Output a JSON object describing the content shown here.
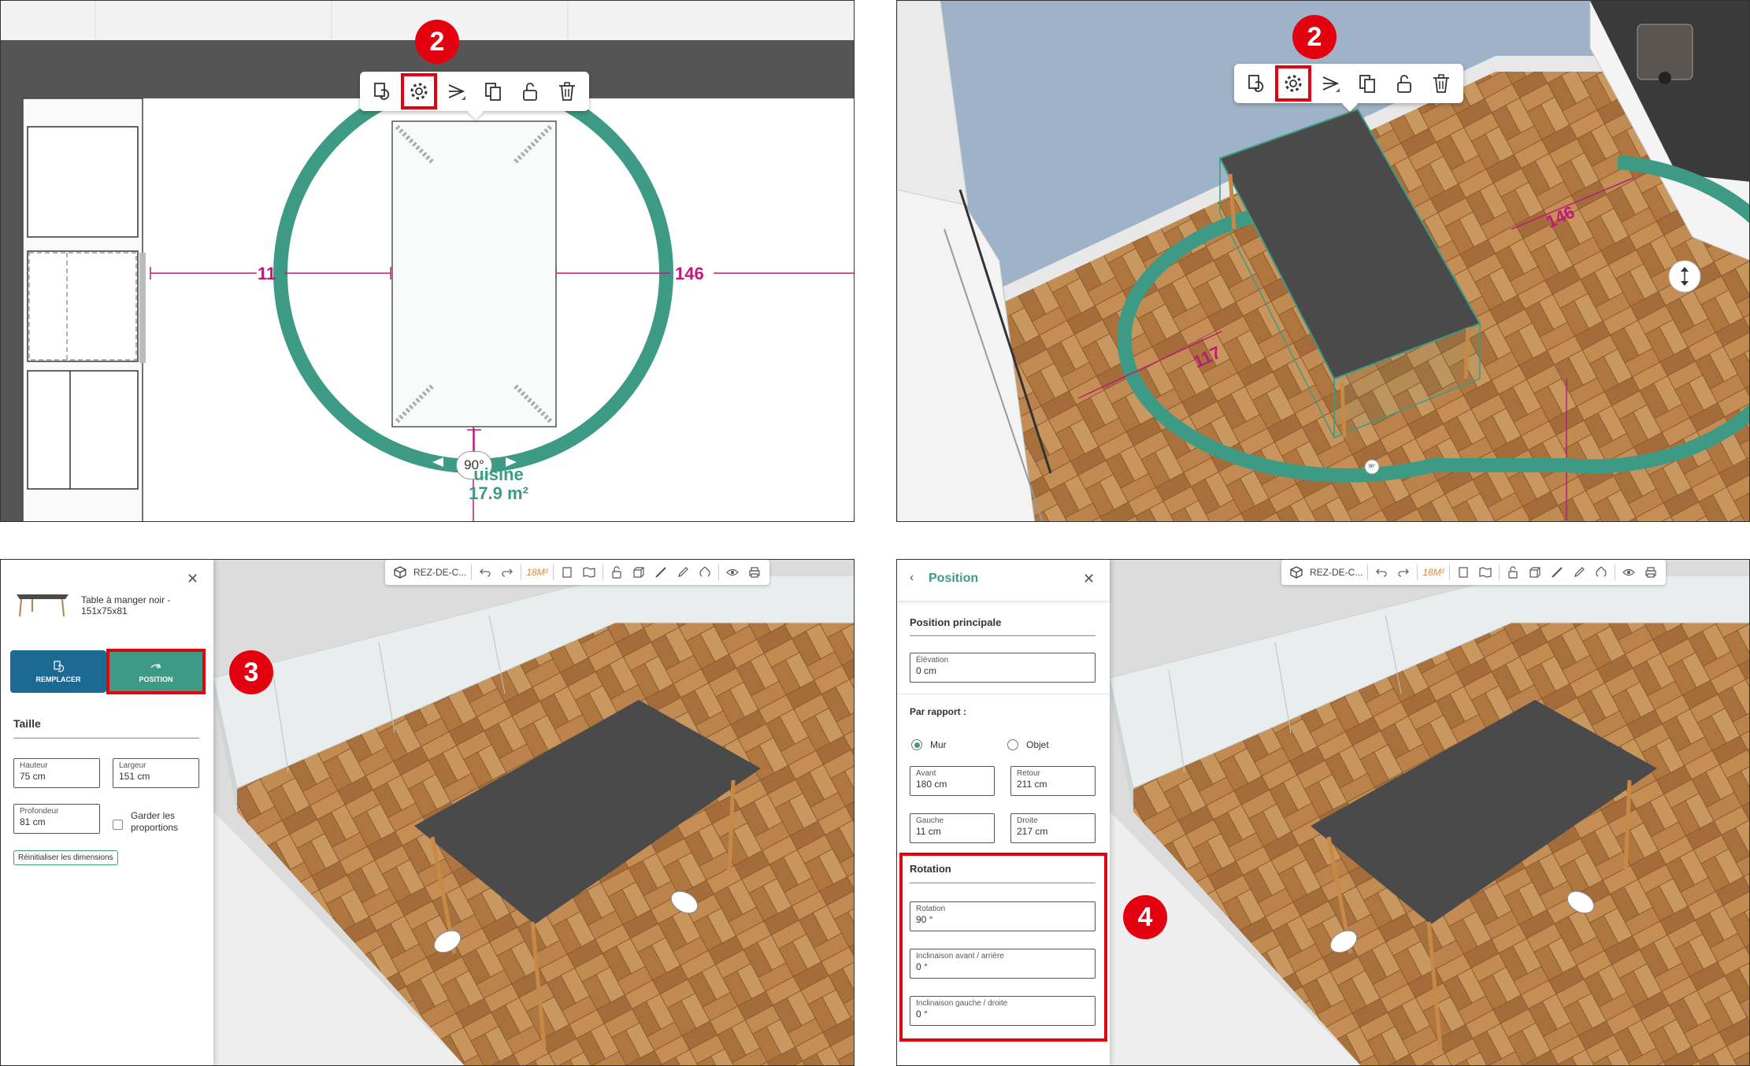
{
  "toolbar_popup": {
    "icons": [
      "replace-icon",
      "gear-icon",
      "align-icon",
      "duplicate-icon",
      "unlock-icon",
      "trash-icon"
    ]
  },
  "steps": {
    "s2a": "2",
    "s2b": "2",
    "s3": "3",
    "s4": "4"
  },
  "plan2d": {
    "dim_left": "11",
    "dim_right": "146",
    "angle": "90°",
    "room_name": "uisine",
    "room_area": "17.9 m²"
  },
  "view3d_top": {
    "dim_left": "117",
    "dim_right": "146",
    "angle": "90°"
  },
  "main_toolbar": {
    "level": "REZ-DE-C...",
    "surface": "18M²"
  },
  "size_panel": {
    "product_name_line1": "Table à  manger noir -",
    "product_name_line2": "151x75x81",
    "replace_label": "REMPLACER",
    "position_label": "POSITION",
    "section_title": "Taille",
    "height_label": "Hauteur",
    "height_value": "75 cm",
    "width_label": "Largeur",
    "width_value": "151 cm",
    "depth_label": "Profondeur",
    "depth_value": "81 cm",
    "keep_prop_line1": "Garder les",
    "keep_prop_line2": "proportions",
    "reset_label": "Réinitialiser les dimensions"
  },
  "position_panel": {
    "title": "Position",
    "main_section": "Position principale",
    "elevation_label": "Élévation",
    "elevation_value": "0 cm",
    "relative_title": "Par rapport :",
    "radio_wall": "Mur",
    "radio_object": "Objet",
    "front_label": "Avant",
    "front_value": "180 cm",
    "back_label": "Retour",
    "back_value": "211 cm",
    "left_label": "Gauche",
    "left_value": "11 cm",
    "right_label": "Droite",
    "right_value": "217 cm",
    "rotation_section": "Rotation",
    "rotation_label": "Rotation",
    "rotation_value": "90 °",
    "tilt_fb_label": "Inclinaison avant / arrière",
    "tilt_fb_value": "0 °",
    "tilt_lr_label": "Inclinaison gauche / droite",
    "tilt_lr_value": "0 °"
  },
  "colors": {
    "accent_green": "#3d9a85",
    "highlight_red": "#e3000f",
    "dimension_magenta": "#c0187a",
    "table_top": "#4a4a4a",
    "floor_wood": "#b07a43"
  }
}
